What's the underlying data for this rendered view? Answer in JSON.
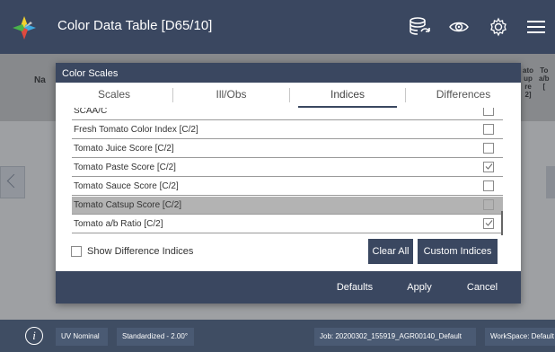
{
  "app": {
    "title": "Color Data Table [D65/10]"
  },
  "background_table": {
    "left_header": "Na",
    "right_header_1": "ato\nup\nre\n2]",
    "right_header_2": "To\na/b\n["
  },
  "dialog": {
    "title": "Color Scales",
    "tabs": [
      {
        "label": "Scales",
        "active": false
      },
      {
        "label": "Ill/Obs",
        "active": false
      },
      {
        "label": "Indices",
        "active": true
      },
      {
        "label": "Differences",
        "active": false
      }
    ],
    "items": [
      {
        "label": "SCAA/C",
        "checked": false,
        "selected": false
      },
      {
        "label": "Fresh Tomato Color Index [C/2]",
        "checked": false,
        "selected": false
      },
      {
        "label": "Tomato Juice Score [C/2]",
        "checked": false,
        "selected": false
      },
      {
        "label": "Tomato Paste Score [C/2]",
        "checked": true,
        "selected": false
      },
      {
        "label": "Tomato Sauce Score [C/2]",
        "checked": false,
        "selected": false
      },
      {
        "label": "Tomato Catsup Score [C/2]",
        "checked": false,
        "selected": true
      },
      {
        "label": "Tomato a/b Ratio [C/2]",
        "checked": true,
        "selected": false
      }
    ],
    "show_difference_indices": {
      "label": "Show Difference Indices",
      "checked": false
    },
    "clear_all_label": "Clear All",
    "custom_indices_label": "Custom Indices",
    "footer": {
      "defaults_label": "Defaults",
      "apply_label": "Apply",
      "cancel_label": "Cancel"
    }
  },
  "statusbar": {
    "uv": "UV Nominal",
    "standardized": "Standardized - 2.00°",
    "job": "Job: 20200302_155919_AGR00140_Default",
    "workspace": "WorkSpace: Default"
  },
  "colors": {
    "primary": "#3a4760",
    "statusbar": "#3f4d63",
    "selected_row": "#b3b3b3"
  }
}
